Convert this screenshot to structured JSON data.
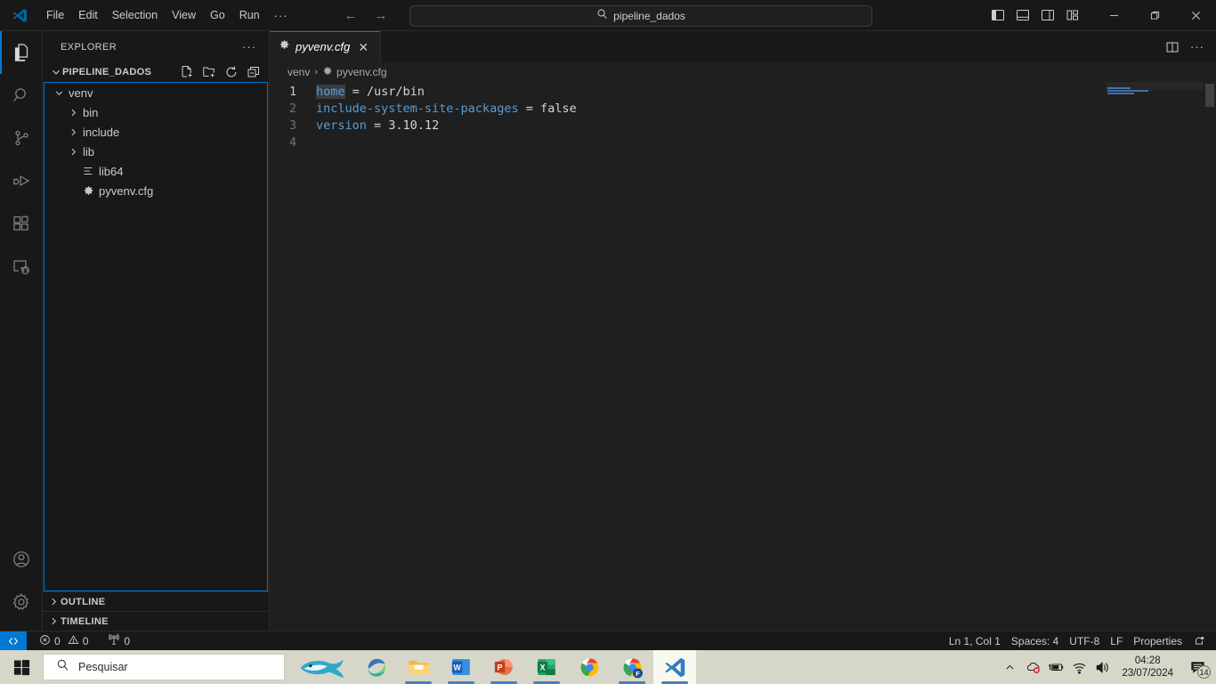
{
  "window": {
    "app_icon": "vscode-logo-icon",
    "menus": [
      "File",
      "Edit",
      "Selection",
      "View",
      "Go",
      "Run"
    ],
    "menu_overflow": "···",
    "nav_back": "←",
    "nav_forward": "→",
    "command_center": {
      "icon": "search-icon",
      "text": "pipeline_dados"
    },
    "layout_buttons": [
      "toggle-primary-sidebar-icon",
      "toggle-panel-icon",
      "toggle-secondary-sidebar-icon",
      "customize-layout-icon"
    ],
    "controls": {
      "minimize": "─",
      "maximize": "❐",
      "close": "✕"
    }
  },
  "activitybar": {
    "items": [
      {
        "name": "explorer",
        "icon": "files-icon",
        "active": true
      },
      {
        "name": "search",
        "icon": "search-icon",
        "active": false
      },
      {
        "name": "source-control",
        "icon": "source-control-icon",
        "active": false
      },
      {
        "name": "run-and-debug",
        "icon": "run-debug-icon",
        "active": false
      },
      {
        "name": "extensions",
        "icon": "extensions-icon",
        "active": false
      },
      {
        "name": "remote-explorer",
        "icon": "remote-explorer-icon",
        "active": false
      }
    ],
    "bottom": [
      {
        "name": "accounts",
        "icon": "account-icon"
      },
      {
        "name": "manage",
        "icon": "gear-icon"
      }
    ]
  },
  "sidebar": {
    "title": "EXPLORER",
    "header_more": "···",
    "folder": {
      "name": "PIPELINE_DADOS",
      "expanded": true,
      "chevron": "⌄",
      "actions": [
        "new-file-icon",
        "new-folder-icon",
        "refresh-icon",
        "collapse-all-icon"
      ]
    },
    "tree": [
      {
        "label": "venv",
        "type": "folder",
        "expanded": true,
        "depth": 0,
        "icon": "folder-icon"
      },
      {
        "label": "bin",
        "type": "folder",
        "expanded": false,
        "depth": 1,
        "icon": "folder-icon"
      },
      {
        "label": "include",
        "type": "folder",
        "expanded": false,
        "depth": 1,
        "icon": "folder-icon"
      },
      {
        "label": "lib",
        "type": "folder",
        "expanded": false,
        "depth": 1,
        "icon": "folder-icon"
      },
      {
        "label": "lib64",
        "type": "symlink",
        "expanded": false,
        "depth": 1,
        "icon": "symlink-icon"
      },
      {
        "label": "pyvenv.cfg",
        "type": "file",
        "expanded": false,
        "depth": 1,
        "icon": "gear-file-icon"
      }
    ],
    "sections": [
      {
        "label": "OUTLINE",
        "expanded": false
      },
      {
        "label": "TIMELINE",
        "expanded": false
      }
    ]
  },
  "editor": {
    "tabs": [
      {
        "label": "pyvenv.cfg",
        "icon": "gear-file-icon",
        "active": true,
        "preview": true,
        "close": "✕"
      }
    ],
    "tab_actions": [
      "split-editor-icon",
      "more-actions-icon"
    ],
    "breadcrumb": [
      {
        "label": "venv",
        "icon": null
      },
      {
        "label": "pyvenv.cfg",
        "icon": "gear-file-icon"
      }
    ],
    "breadcrumb_separator": "›",
    "line_numbers": [
      "1",
      "2",
      "3",
      "4"
    ],
    "lines": [
      {
        "key": "home",
        "op": " = ",
        "value": "/usr/bin",
        "selected_key": true
      },
      {
        "key": "include-system-site-packages",
        "op": " = ",
        "value": "false",
        "selected_key": false
      },
      {
        "key": "version",
        "op": " = ",
        "value": "3.10.12",
        "selected_key": false
      },
      {
        "key": "",
        "op": "",
        "value": "",
        "selected_key": false
      }
    ],
    "colors": {
      "key": "#569cd6",
      "value": "#d4d4d4",
      "selection": "#3a3d41"
    }
  },
  "statusbar": {
    "remote": {
      "icon": "remote-icon",
      "label": ""
    },
    "left": [
      {
        "name": "problems",
        "icon": "error-icon",
        "value": "0",
        "icon2": "warning-icon",
        "value2": "0"
      },
      {
        "name": "ports",
        "icon": "radio-tower-icon",
        "value": "0"
      }
    ],
    "right": [
      {
        "name": "cursor-position",
        "label": "Ln 1, Col 1"
      },
      {
        "name": "indentation",
        "label": "Spaces: 4"
      },
      {
        "name": "encoding",
        "label": "UTF-8"
      },
      {
        "name": "end-of-line",
        "label": "LF"
      },
      {
        "name": "language-mode",
        "label": "Properties"
      }
    ],
    "bell": "notifications-bell-icon"
  },
  "taskbar": {
    "start": "windows-start-icon",
    "search_placeholder": "Pesquisar",
    "search_icon": "search-icon",
    "apps": [
      {
        "name": "cortana-fish-widget",
        "active": false,
        "running": false
      },
      {
        "name": "microsoft-edge",
        "active": false,
        "running": true
      },
      {
        "name": "file-explorer",
        "active": false,
        "running": true
      },
      {
        "name": "microsoft-word",
        "active": false,
        "running": true
      },
      {
        "name": "microsoft-powerpoint",
        "active": false,
        "running": true
      },
      {
        "name": "microsoft-excel",
        "active": false,
        "running": true
      },
      {
        "name": "google-chrome",
        "active": false,
        "running": false
      },
      {
        "name": "google-chrome-profile-f",
        "active": false,
        "running": true
      },
      {
        "name": "visual-studio-code",
        "active": true,
        "running": true
      }
    ],
    "tray": {
      "overflow": "˄",
      "icons": [
        "onedrive-error-icon",
        "battery-icon",
        "wifi-icon",
        "volume-icon"
      ],
      "time": "04:28",
      "date": "23/07/2024",
      "notifications_count": "14"
    }
  }
}
